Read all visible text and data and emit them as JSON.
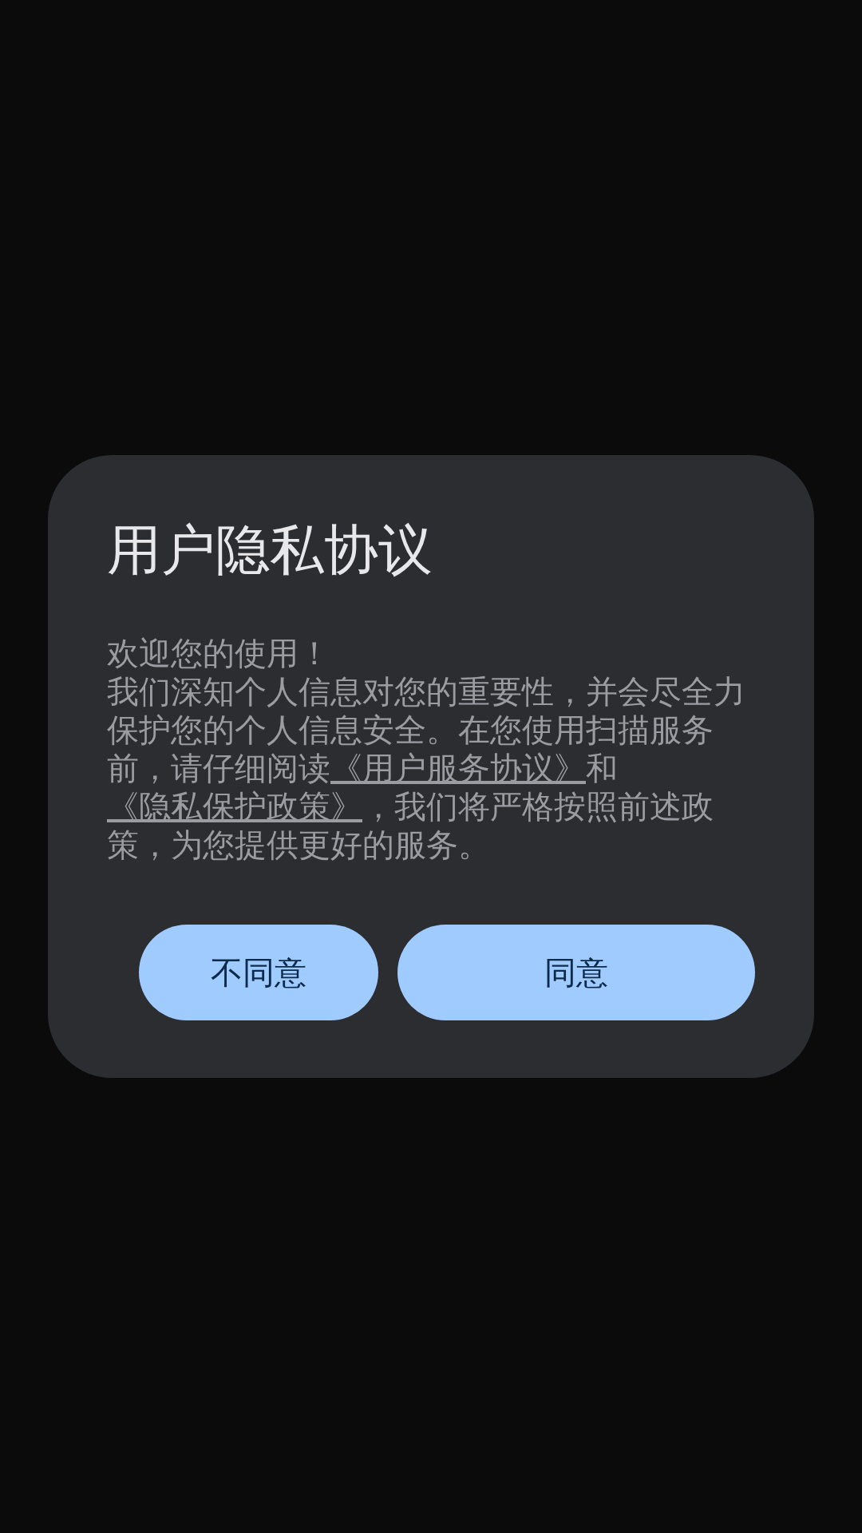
{
  "dialog": {
    "title": "用户隐私协议",
    "greeting": "欢迎您的使用！",
    "body": [
      {
        "kind": "text",
        "text": "我们深知个人信息对您的重要性，并会尽全力保护您的个人信息安全。在您使用扫描服务前，请仔细阅读"
      },
      {
        "kind": "link",
        "text": "《用户服务协议》"
      },
      {
        "kind": "text",
        "text": "和"
      },
      {
        "kind": "link",
        "text": "《隐私保护政策》"
      },
      {
        "kind": "text",
        "text": "，我们将严格按照前述政策，为您提供更好的服务。"
      }
    ],
    "buttons": [
      {
        "label": "不同意",
        "kind": "decline"
      },
      {
        "label": "同意",
        "kind": "accept"
      }
    ]
  }
}
